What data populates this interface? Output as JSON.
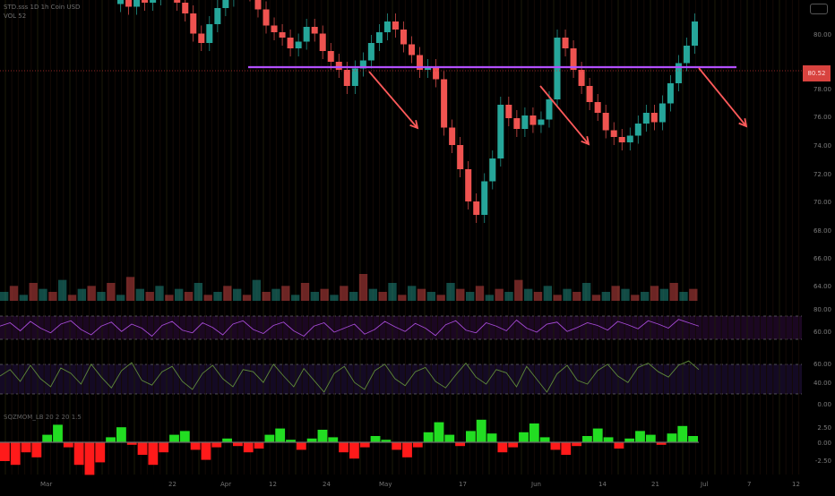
{
  "header": {
    "symbol_line": "STD.sss  1D  1h  Coin USD",
    "subline": "VOL 52"
  },
  "price_tag": "80.52",
  "y_axis": {
    "price": [
      "80.00",
      "78.00",
      "76.00",
      "74.00",
      "72.00",
      "70.00",
      "68.00",
      "66.00",
      "64.00"
    ],
    "rsi": [
      "80.00",
      "60.00"
    ],
    "stoch": [
      "60.00",
      "40.00",
      "0.00"
    ],
    "macd": [
      "2.50",
      "0.00",
      "-2.50"
    ]
  },
  "x_axis": [
    "Mar",
    "22",
    "Apr",
    "12",
    "24",
    "May",
    "17",
    "Jun",
    "14",
    "21",
    "Jul",
    "7",
    "12"
  ],
  "indicators": {
    "rsi_title": "",
    "stoch_title": "",
    "macd_title": "SQZMOM_LB  20  2  20  1.5"
  },
  "colors": {
    "up": "#26a69a",
    "down": "#ef5350",
    "resistance": "#b24fff",
    "arrow": "#ff5a5a",
    "rsi_line": "#a64bd6",
    "stoch_line": "#5f8a3a",
    "macd_up": "#22dd22",
    "macd_down": "#ff1a1a"
  },
  "chart_data": {
    "type": "candlestick",
    "title": "",
    "ylim": [
      62,
      82
    ],
    "resistance_level": 80.3,
    "close_series": [
      82,
      81.5,
      82.5,
      81.8,
      82.2,
      83,
      82.6,
      81.8,
      81,
      79.5,
      78.8,
      80.2,
      81.4,
      82.1,
      82.8,
      83.2,
      82.5,
      81.3,
      80.1,
      79.6,
      79.2,
      78.4,
      78.9,
      80.0,
      79.5,
      78.2,
      77.4,
      76.8,
      75.6,
      76.9,
      77.5,
      78.8,
      79.6,
      80.4,
      79.8,
      78.7,
      77.9,
      76.8,
      77.0,
      76.1,
      72.5,
      71.2,
      69.4,
      67.0,
      66.0,
      68.5,
      70.2,
      74.2,
      73.2,
      72.4,
      73.4,
      72.7,
      73.1,
      74.6,
      79.2,
      78.4,
      76.8,
      75.6,
      74.4,
      73.6,
      72.3,
      71.8,
      71.4,
      71.9,
      72.8,
      73.6,
      72.9,
      74.3,
      75.8,
      77.3,
      78.6,
      80.4
    ],
    "volume_series": [
      3,
      5,
      2,
      6,
      4,
      3,
      7,
      2,
      4,
      5,
      3,
      6,
      2,
      8,
      4,
      3,
      5,
      2,
      4,
      3,
      6,
      2,
      3,
      5,
      4,
      2,
      7,
      3,
      4,
      5,
      2,
      6,
      3,
      4,
      2,
      5,
      3,
      9,
      4,
      3,
      6,
      2,
      5,
      4,
      3,
      2,
      6,
      4,
      3,
      5,
      2,
      4,
      3,
      7,
      4,
      3,
      5,
      2,
      4,
      3,
      6,
      2,
      3,
      5,
      4,
      2,
      3,
      5,
      4,
      6,
      3,
      4
    ],
    "rsi_series": [
      55,
      60,
      48,
      62,
      52,
      45,
      58,
      63,
      50,
      42,
      55,
      61,
      47,
      58,
      52,
      40,
      56,
      62,
      49,
      45,
      60,
      53,
      42,
      58,
      63,
      50,
      44,
      56,
      61,
      48,
      40,
      55,
      60,
      46,
      52,
      58,
      43,
      50,
      62,
      54,
      47,
      59,
      52,
      41,
      57,
      63,
      49,
      45,
      60,
      55,
      48,
      64,
      52,
      46,
      58,
      61,
      47,
      53,
      60,
      56,
      49,
      62,
      57,
      51,
      63,
      58,
      52,
      65,
      60,
      55
    ],
    "stoch_series": [
      50,
      62,
      40,
      70,
      45,
      30,
      65,
      55,
      35,
      72,
      48,
      28,
      60,
      75,
      42,
      33,
      58,
      68,
      40,
      25,
      55,
      70,
      45,
      30,
      62,
      58,
      38,
      72,
      50,
      30,
      64,
      42,
      20,
      55,
      68,
      38,
      25,
      60,
      72,
      45,
      32,
      58,
      66,
      40,
      28,
      52,
      74,
      48,
      35,
      62,
      56,
      30,
      68,
      44,
      20,
      54,
      70,
      42,
      35,
      60,
      72,
      50,
      38,
      66,
      74,
      58,
      48,
      70,
      78,
      62
    ],
    "macd_series": [
      -1.5,
      -1.8,
      -0.8,
      -1.2,
      0.6,
      1.4,
      -0.4,
      -1.8,
      -2.6,
      -1.6,
      0.4,
      1.2,
      -0.2,
      -1.0,
      -1.8,
      -0.8,
      0.6,
      0.9,
      -0.6,
      -1.4,
      -0.4,
      0.3,
      -0.3,
      -0.8,
      -0.5,
      0.6,
      1.1,
      0.2,
      -0.6,
      0.3,
      1.0,
      0.4,
      -0.8,
      -1.3,
      -0.4,
      0.5,
      0.2,
      -0.6,
      -1.2,
      -0.4,
      0.8,
      1.6,
      0.6,
      -0.3,
      0.9,
      1.8,
      0.7,
      -0.8,
      -0.4,
      0.8,
      1.5,
      0.4,
      -0.6,
      -1.0,
      -0.3,
      0.5,
      1.1,
      0.4,
      -0.5,
      0.3,
      0.9,
      0.6,
      -0.2,
      0.7,
      1.3,
      0.5
    ]
  }
}
